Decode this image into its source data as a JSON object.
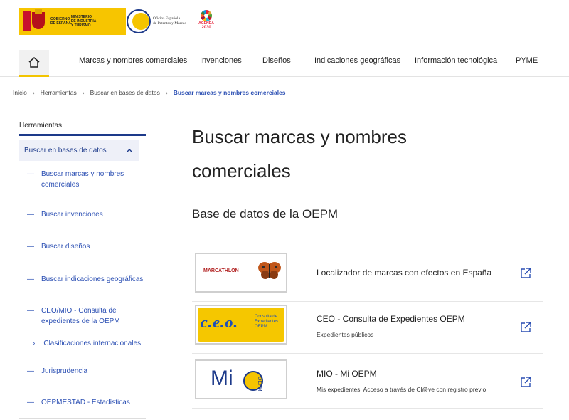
{
  "header": {
    "gov_logo_lines": [
      "GOBIERNO",
      "DE ESPAÑA",
      "MINISTERIO",
      "DE INDUSTRIA",
      "Y TURISMO"
    ],
    "oepm_logo_lines": [
      "Oficina Española",
      "de Patentes y Marcas"
    ],
    "agenda_label": "AGENDA",
    "agenda_year": "2030"
  },
  "nav": {
    "items": [
      {
        "label": "Marcas y nombres comerciales"
      },
      {
        "label": "Invenciones"
      },
      {
        "label": "Diseños"
      },
      {
        "label": "Indicaciones geográficas"
      },
      {
        "label": "Información tecnológica"
      },
      {
        "label": "PYME"
      }
    ],
    "home_icon": "home-icon",
    "accent": "#f2c400"
  },
  "breadcrumb": {
    "items": [
      "Inicio",
      "Herramientas",
      "Buscar en bases de datos"
    ],
    "current": "Buscar marcas y nombres comerciales"
  },
  "sidebar": {
    "title": "Herramientas",
    "active_section": "Buscar en bases de datos",
    "items": [
      {
        "label": "Buscar marcas y nombres comerciales"
      },
      {
        "label": "Buscar invenciones"
      },
      {
        "label": "Buscar diseños"
      },
      {
        "label": "Buscar indicaciones geográficas"
      },
      {
        "label": "CEO/MIO - Consulta de expedientes de la OEPM"
      },
      {
        "label": "Jurisprudencia"
      },
      {
        "label": "OEPMESTAD - Estadísticas"
      }
    ],
    "subitem": "Clasificaciones internacionales",
    "dash": "—",
    "chevron": "›",
    "link_color": "#2b4fb3"
  },
  "main": {
    "title": "Buscar marcas y nombres comerciales",
    "subtitle": "Base de datos de la OEPM",
    "resources": [
      {
        "title": "Localizador de marcas con efectos en España",
        "desc": "",
        "thumb_text": "MARCATHLON",
        "icon": "external-link-icon"
      },
      {
        "title": "CEO - Consulta de Expedientes OEPM",
        "desc": "Expedientes públicos",
        "thumb_text": "c.e.o.",
        "thumb_sub": "Consulta de Expedientes OEPM",
        "icon": "external-link-icon"
      },
      {
        "title": "MIO - Mi OEPM",
        "desc": "Mis expedientes. Acceso a través de Cl@ve con registro previo",
        "thumb_text": "Mi",
        "thumb_sub": "OEPM",
        "icon": "external-link-icon"
      }
    ]
  }
}
